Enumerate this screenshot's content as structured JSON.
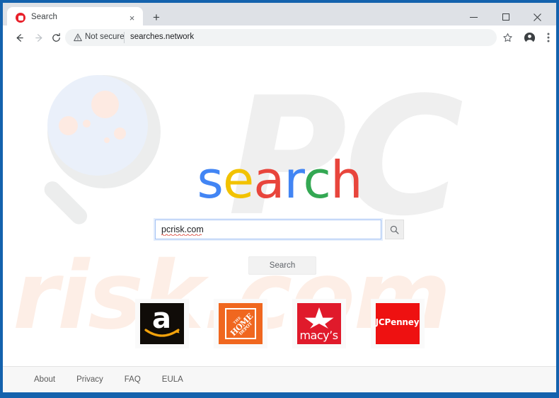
{
  "browser": {
    "tab": {
      "title": "Search",
      "favicon": "red-ring-favicon",
      "close_label": "×"
    },
    "new_tab_label": "+",
    "window_controls": {
      "minimize": "minimize-icon",
      "maximize": "maximize-icon",
      "close": "✕"
    },
    "nav": {
      "back": "back-arrow-icon",
      "forward": "forward-arrow-icon",
      "reload": "reload-icon"
    },
    "omnibox": {
      "security_label": "Not secure",
      "security_icon": "warning-triangle-icon",
      "url": "searches.network"
    },
    "toolbar_icons": {
      "bookmark": "star-icon",
      "profile": "account-avatar-icon",
      "menu": "three-dot-menu-icon"
    }
  },
  "page": {
    "watermarks": {
      "brand_top": "PC",
      "brand_bottom": "risk.com"
    },
    "logo": {
      "letters": [
        {
          "char": "s",
          "color": "#4285f4"
        },
        {
          "char": "e",
          "color": "#f2c200"
        },
        {
          "char": "a",
          "color": "#e8453c"
        },
        {
          "char": "r",
          "color": "#4285f4"
        },
        {
          "char": "c",
          "color": "#34a853"
        },
        {
          "char": "h",
          "color": "#e8453c"
        }
      ]
    },
    "search": {
      "value": "pcrisk.com",
      "placeholder": "",
      "go_icon": "magnifier-icon",
      "button_label": "Search"
    },
    "tiles": [
      {
        "name": "Amazon",
        "letter": "a",
        "bg": "#100c08",
        "style": "amazon"
      },
      {
        "name": "The Home Depot",
        "line1": "THE",
        "line2": "HOME",
        "line3": "DEPOT",
        "bg": "#f0671f",
        "style": "homedepot"
      },
      {
        "name": "Macy's",
        "word": "macy’s",
        "bg": "#e01a2b",
        "style": "macys"
      },
      {
        "name": "JCPenney",
        "word": "JCPenney",
        "bg": "#ee1111",
        "style": "jcpenney"
      }
    ],
    "footer_links": [
      {
        "label": "About"
      },
      {
        "label": "Privacy"
      },
      {
        "label": "FAQ"
      },
      {
        "label": "EULA"
      }
    ]
  }
}
